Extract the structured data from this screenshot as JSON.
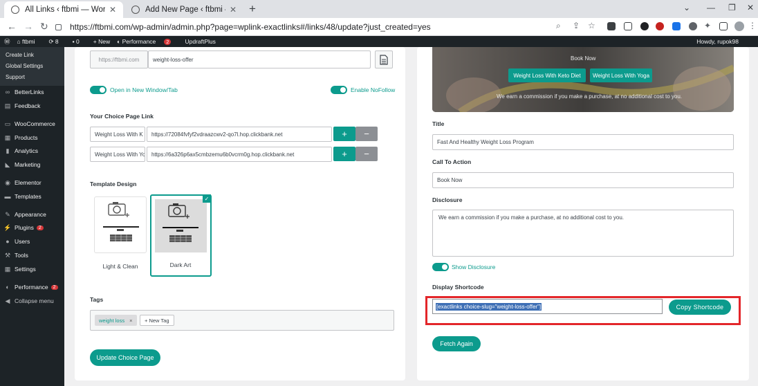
{
  "browser": {
    "tabs": [
      {
        "title": "All Links ‹ ftbmi — WordPress",
        "active": true
      },
      {
        "title": "Add New Page ‹ ftbmi — WordPr",
        "active": false
      }
    ],
    "url": "https://ftbmi.com/wp-admin/admin.php?page=wplink-exactlinks#/links/48/update?just_created=yes"
  },
  "adminbar": {
    "site": "ftbmi",
    "updates": "8",
    "comments": "0",
    "new": "+ New",
    "performance": "Performance",
    "performance_badge": "2",
    "updraft": "UpdraftPlus",
    "howdy": "Howdy, rupok98"
  },
  "sidebar": {
    "submenu": [
      "Create Link",
      "Global Settings",
      "Support"
    ],
    "items": [
      {
        "label": "BetterLinks",
        "icon": "link-icon"
      },
      {
        "label": "Feedback",
        "icon": "feedback-icon"
      },
      {
        "label": "WooCommerce",
        "icon": "woocommerce-icon"
      },
      {
        "label": "Products",
        "icon": "products-icon"
      },
      {
        "label": "Analytics",
        "icon": "analytics-icon"
      },
      {
        "label": "Marketing",
        "icon": "marketing-icon"
      },
      {
        "label": "Elementor",
        "icon": "elementor-icon"
      },
      {
        "label": "Templates",
        "icon": "templates-icon"
      },
      {
        "label": "Appearance",
        "icon": "appearance-icon"
      },
      {
        "label": "Plugins",
        "icon": "plugins-icon",
        "badge": "2"
      },
      {
        "label": "Users",
        "icon": "users-icon"
      },
      {
        "label": "Tools",
        "icon": "tools-icon"
      },
      {
        "label": "Settings",
        "icon": "settings-icon"
      },
      {
        "label": "Performance",
        "icon": "performance-icon",
        "badge": "2"
      },
      {
        "label": "Collapse menu",
        "icon": "collapse-icon"
      }
    ]
  },
  "left": {
    "slug_prefix": "https://ftbmi.com",
    "slug_value": "weight-loss-offer",
    "open_new_window": "Open in New Window/Tab",
    "enable_nofollow": "Enable NoFollow",
    "choice_page_link_label": "Your Choice Page Link",
    "links": [
      {
        "name": "Weight Loss With K",
        "url": "https://72084fvfyf2vdraazcwv2-qo7l.hop.clickbank.net"
      },
      {
        "name": "Weight Loss With Yo",
        "url": "https://6a326p6ax5cmbzemu6b0vcrm0g.hop.clickbank.net"
      }
    ],
    "template_design_label": "Template Design",
    "templates": [
      {
        "name": "Light & Clean",
        "selected": false
      },
      {
        "name": "Dark Art",
        "selected": true
      }
    ],
    "tags_label": "Tags",
    "tag": "weight loss",
    "new_tag": "+ New Tag",
    "update_button": "Update Choice Page"
  },
  "right": {
    "hero": {
      "book_now": "Book Now",
      "btn_keto": "Weight Loss With Keto Diet",
      "btn_yoga": "Weight Loss With Yoga",
      "disclosure": "We earn a commission if you make a purchase, at no additional cost to you."
    },
    "title_label": "Title",
    "title_value": "Fast And Healthy Weight Loss Program",
    "cta_label": "Call To Action",
    "cta_value": "Book Now",
    "disclosure_label": "Disclosure",
    "disclosure_value": "We earn a commission if you make a purchase, at no additional cost to you.",
    "show_disclosure": "Show Disclosure",
    "display_shortcode_label": "Display Shortcode",
    "shortcode": "[exactlinks choice-slug=\"weight-loss-offer\"]",
    "copy_button": "Copy Shortcode",
    "fetch_button": "Fetch Again"
  }
}
